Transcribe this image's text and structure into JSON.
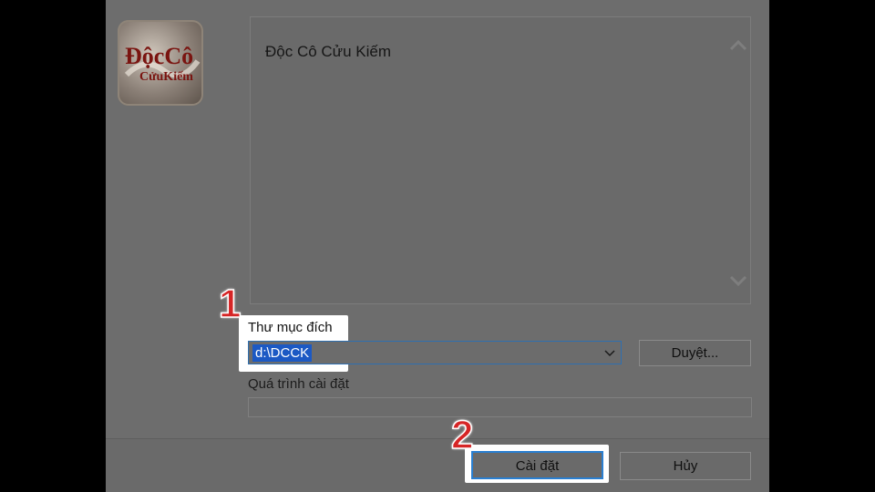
{
  "app": {
    "description_text": "Độc Cô Cửu Kiếm",
    "logo_text": "Độc Cô Cửu Kiếm"
  },
  "destination": {
    "label": "Thư mục đích",
    "value": "d:\\DCCK",
    "browse_label": "Duyệt..."
  },
  "progress": {
    "label": "Quá trình cài đặt",
    "value": 0
  },
  "buttons": {
    "install_label": "Cài đặt",
    "cancel_label": "Hủy"
  },
  "annotations": {
    "step1": "1",
    "step2": "2",
    "marker_color": "#d62526"
  },
  "icons": {
    "scroll_up": "chevron-up-icon",
    "scroll_down": "chevron-down-icon",
    "combo": "chevron-down-icon"
  }
}
